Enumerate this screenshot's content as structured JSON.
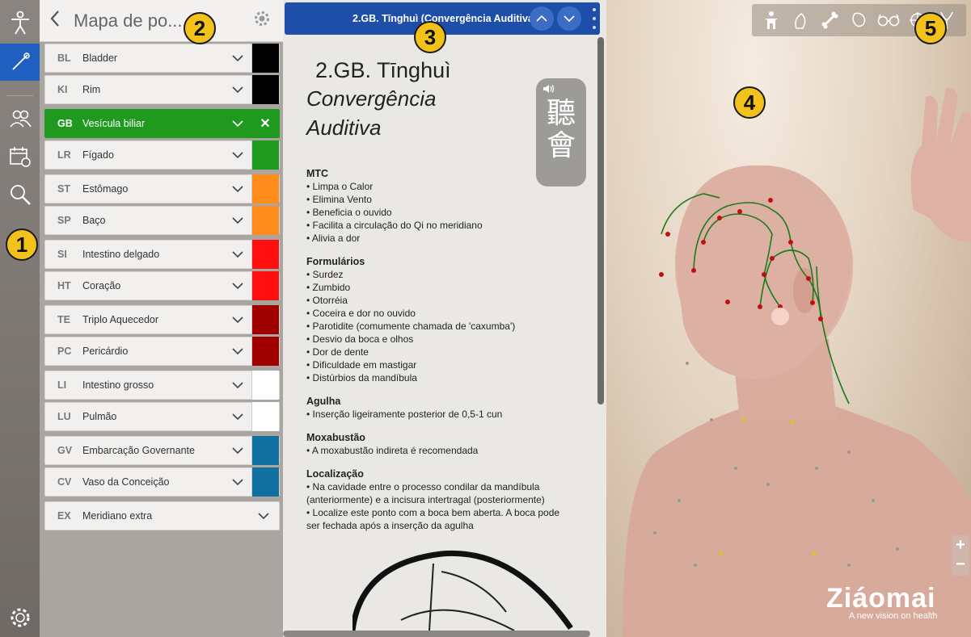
{
  "panel": {
    "title": "Mapa de po...",
    "back_icon": "chevron-left-icon",
    "settings_icon": "gear-icon"
  },
  "rail": {
    "icons": [
      "body-icon",
      "needle-icon",
      "users-icon",
      "calendar-icon",
      "search-icon",
      "settings-icon"
    ]
  },
  "meridians": [
    {
      "abbr": "BL",
      "name": "Bladder",
      "color": "#000000"
    },
    {
      "abbr": "KI",
      "name": "Rim",
      "color": "#000000"
    },
    {
      "abbr": "GB",
      "name": "Vesícula biliar",
      "color": "#1f9a1f",
      "selected": true
    },
    {
      "abbr": "LR",
      "name": "Fígado",
      "color": "#1f9a1f"
    },
    {
      "abbr": "ST",
      "name": "Estômago",
      "color": "#ff8c1a"
    },
    {
      "abbr": "SP",
      "name": "Baço",
      "color": "#ff8c1a"
    },
    {
      "abbr": "SI",
      "name": "Intestino delgado",
      "color": "#ff1010"
    },
    {
      "abbr": "HT",
      "name": "Coração",
      "color": "#ff1010"
    },
    {
      "abbr": "TE",
      "name": "Triplo Aquecedor",
      "color": "#a00000"
    },
    {
      "abbr": "PC",
      "name": "Pericárdio",
      "color": "#a00000"
    },
    {
      "abbr": "LI",
      "name": "Intestino grosso",
      "color": "#ffffff"
    },
    {
      "abbr": "LU",
      "name": "Pulmão",
      "color": "#ffffff"
    },
    {
      "abbr": "GV",
      "name": "Embarcação Governante",
      "color": "#1070a0"
    },
    {
      "abbr": "CV",
      "name": "Vaso da Conceição",
      "color": "#1070a0"
    },
    {
      "abbr": "EX",
      "name": "Meridiano extra",
      "color": null
    }
  ],
  "detail": {
    "bar_title": "2.GB. Tīnghuì (Convergência Auditiva)",
    "code": "2.GB. Tīnghuì",
    "name_line1": "Convergência",
    "name_line2": "Auditiva",
    "hanzi1": "聽",
    "hanzi2": "會",
    "sections": [
      {
        "title": "MTC",
        "items": [
          "• Limpa o Calor",
          "• Elimina Vento",
          "• Beneficia o ouvido",
          "• Facilita a circulação do Qi no meridiano",
          "• Alivia a dor"
        ]
      },
      {
        "title": "Formulários",
        "items": [
          "• Surdez",
          "• Zumbido",
          "• Otorréia",
          "• Coceira e dor no ouvido",
          "• Parotidite (comumente chamada de 'caxumba')",
          "• Desvio da boca e olhos",
          "• Dor de dente",
          "• Dificuldade em mastigar",
          "• Distúrbios da mandíbula"
        ]
      },
      {
        "title": "Agulha",
        "items": [
          "• Inserção ligeiramente posterior de 0,5-1 cun"
        ]
      },
      {
        "title": "Moxabustão",
        "items": [
          "• A moxabustão indireta é recomendada"
        ]
      },
      {
        "title": "Localização",
        "items": [
          "• Na cavidade entre o processo condilar da mandíbula",
          "(anteriormente) e a incisura intertragal (posteriormente)",
          "• Localize este ponto com a boca bem aberta. A boca pode",
          "ser fechada após a inserção da agulha"
        ]
      }
    ]
  },
  "view": {
    "toolbar_icons": [
      "person-icon",
      "muscle-icon",
      "bone-icon",
      "organ-icon",
      "glasses-icon",
      "target-icon",
      "meridian-icon"
    ],
    "zoom_in": "+",
    "zoom_out": "−",
    "brand": "Ziáomai",
    "tagline": "A new vision on health"
  },
  "badges": [
    "1",
    "2",
    "3",
    "4",
    "5"
  ]
}
